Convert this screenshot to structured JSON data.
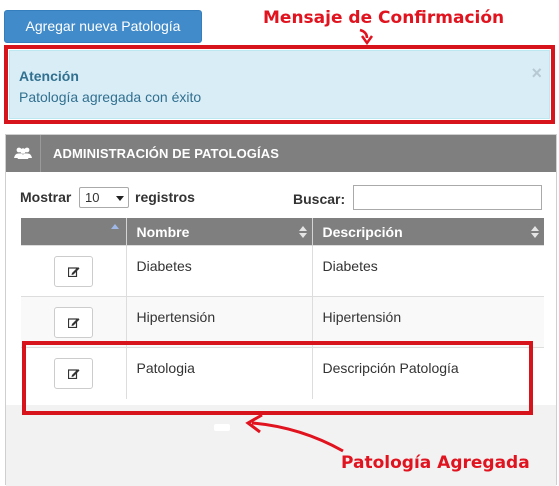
{
  "toolbar": {
    "add_button": "Agregar nueva Patología"
  },
  "annotations": {
    "top": "Mensaje de Confirmación",
    "bottom": "Patología Agregada"
  },
  "alert": {
    "title": "Atención",
    "message": "Patología agregada con éxito",
    "close": "×"
  },
  "panel": {
    "title": "ADMINISTRACIÓN DE PATOLOGÍAS",
    "icon": "users-icon"
  },
  "controls": {
    "show_label": "Mostrar",
    "page_size": "10",
    "records_label": "registros",
    "search_label": "Buscar:",
    "search_value": ""
  },
  "table": {
    "headers": [
      "",
      "Nombre",
      "Descripción"
    ],
    "rows": [
      {
        "nombre": "Diabetes",
        "descripcion": "Diabetes"
      },
      {
        "nombre": "Hipertensión",
        "descripcion": "Hipertensión"
      },
      {
        "nombre": "Patologia",
        "descripcion": "Descripción Patología"
      }
    ]
  },
  "colors": {
    "primary": "#428bca",
    "annotation": "#e0131f",
    "alert_bg": "#d9edf7",
    "alert_text": "#31708f",
    "panel_header": "#7f7f7f"
  }
}
